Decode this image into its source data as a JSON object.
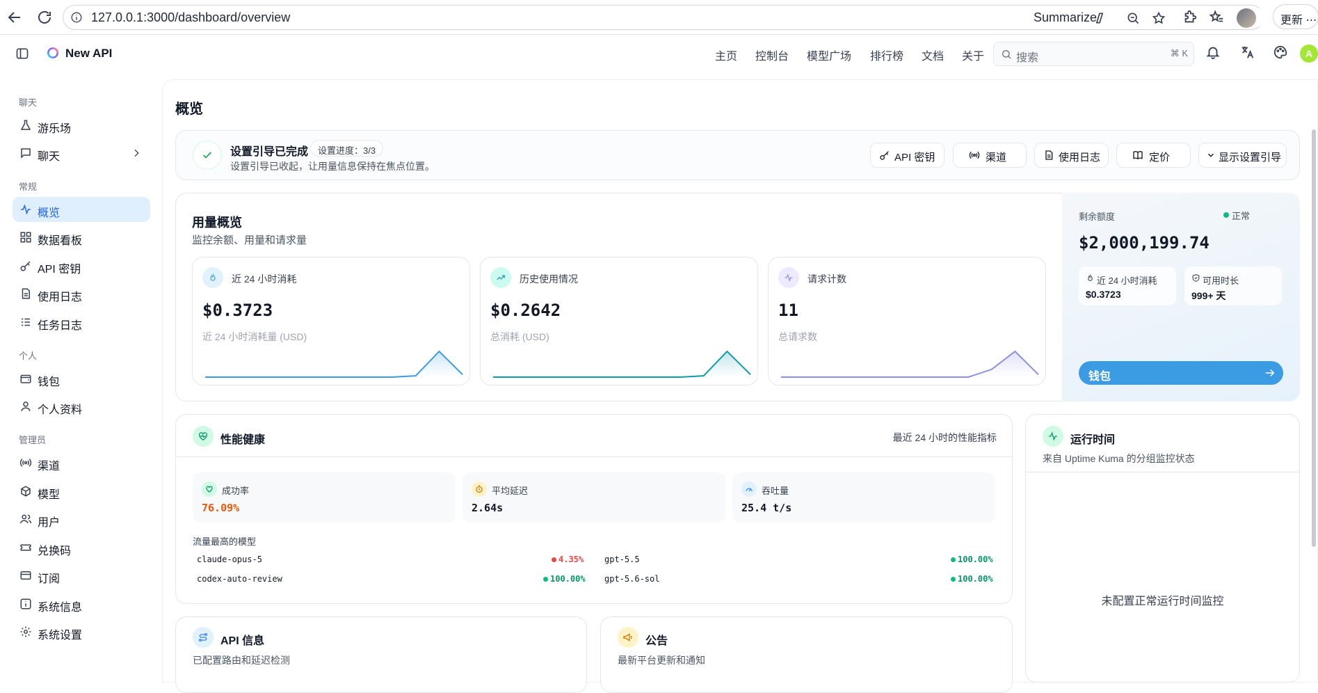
{
  "browser": {
    "url": "127.0.0.1:3000/dashboard/overview",
    "summarize_label": "Summarize",
    "update_label": "更新 ⋯"
  },
  "app": {
    "name": "New API",
    "nav": [
      "主页",
      "控制台",
      "模型广场",
      "排行榜",
      "文档",
      "关于"
    ],
    "search_placeholder": "搜索",
    "search_shortcut": "⌘ K",
    "avatar_letter": "A"
  },
  "sidebar": {
    "groups": [
      {
        "title": "聊天",
        "items": [
          {
            "label": "游乐场",
            "icon": "flask-icon"
          },
          {
            "label": "聊天",
            "icon": "chat-icon",
            "expandable": true
          }
        ]
      },
      {
        "title": "常规",
        "items": [
          {
            "label": "概览",
            "icon": "activity-icon",
            "active": true
          },
          {
            "label": "数据看板",
            "icon": "dashboard-icon"
          },
          {
            "label": "API 密钥",
            "icon": "key-icon"
          },
          {
            "label": "使用日志",
            "icon": "file-icon"
          },
          {
            "label": "任务日志",
            "icon": "list-icon"
          }
        ]
      },
      {
        "title": "个人",
        "items": [
          {
            "label": "钱包",
            "icon": "wallet-icon"
          },
          {
            "label": "个人资料",
            "icon": "user-icon"
          }
        ]
      },
      {
        "title": "管理员",
        "items": [
          {
            "label": "渠道",
            "icon": "radio-icon"
          },
          {
            "label": "模型",
            "icon": "cube-icon"
          },
          {
            "label": "用户",
            "icon": "users-icon"
          },
          {
            "label": "兑换码",
            "icon": "ticket-icon"
          },
          {
            "label": "订阅",
            "icon": "card-icon"
          },
          {
            "label": "系统信息",
            "icon": "info-icon"
          },
          {
            "label": "系统设置",
            "icon": "settings-icon"
          }
        ]
      }
    ]
  },
  "page": {
    "title": "概览"
  },
  "setup": {
    "title": "设置引导已完成",
    "progress": "设置进度：3/3",
    "desc": "设置引导已收起，让用量信息保持在焦点位置。",
    "buttons": [
      "API 密钥",
      "渠道",
      "使用日志",
      "定价",
      "显示设置引导"
    ]
  },
  "usage": {
    "title": "用量概览",
    "subtitle": "监控余额、用量和请求量",
    "metrics": [
      {
        "label": "近 24 小时消耗",
        "value": "$0.3723",
        "sub": "近 24 小时消耗量 (USD)",
        "color": "#3b9be3",
        "spark": [
          0,
          0,
          0,
          0,
          0,
          0,
          0,
          0,
          0,
          0.05,
          1,
          0.1
        ]
      },
      {
        "label": "历史使用情况",
        "value": "$0.2642",
        "sub": "总消耗 (USD)",
        "color": "#0f9aa8",
        "spark": [
          0,
          0,
          0,
          0,
          0,
          0,
          0,
          0,
          0,
          0.05,
          1,
          0.1
        ]
      },
      {
        "label": "请求计数",
        "value": "11",
        "sub": "总请求数",
        "color": "#8b8fe0",
        "spark": [
          0,
          0,
          0,
          0,
          0,
          0,
          0,
          0,
          0,
          0.3,
          1,
          0.1
        ]
      }
    ]
  },
  "balance": {
    "label": "剩余额度",
    "status": "正常",
    "value": "$2,000,199.74",
    "sub": [
      {
        "label": "近 24 小时消耗",
        "value": "$0.3723"
      },
      {
        "label": "可用时长",
        "value": "999+ 天"
      }
    ],
    "wallet_label": "钱包"
  },
  "perf": {
    "title": "性能健康",
    "range": "最近 24 小时的性能指标",
    "metrics": [
      {
        "label": "成功率",
        "value": "76.09%",
        "color": "#ea580c"
      },
      {
        "label": "平均延迟",
        "value": "2.64s",
        "color": "#111827"
      },
      {
        "label": "吞吐量",
        "value": "25.4 t/s",
        "color": "#111827"
      }
    ],
    "top_models_title": "流量最高的模型",
    "models": [
      {
        "name": "claude-opus-5",
        "pct": "4.35%",
        "color": "#ef4444"
      },
      {
        "name": "gpt-5.5",
        "pct": "100.00%",
        "color": "#059669"
      },
      {
        "name": "codex-auto-review",
        "pct": "100.00%",
        "color": "#059669"
      },
      {
        "name": "gpt-5.6-sol",
        "pct": "100.00%",
        "color": "#059669"
      }
    ]
  },
  "uptime": {
    "title": "运行时间",
    "subtitle": "来自 Uptime Kuma 的分组监控状态",
    "empty": "未配置正常运行时间监控"
  },
  "api_info": {
    "title": "API 信息",
    "subtitle": "已配置路由和延迟检测"
  },
  "notice": {
    "title": "公告",
    "subtitle": "最新平台更新和通知"
  }
}
